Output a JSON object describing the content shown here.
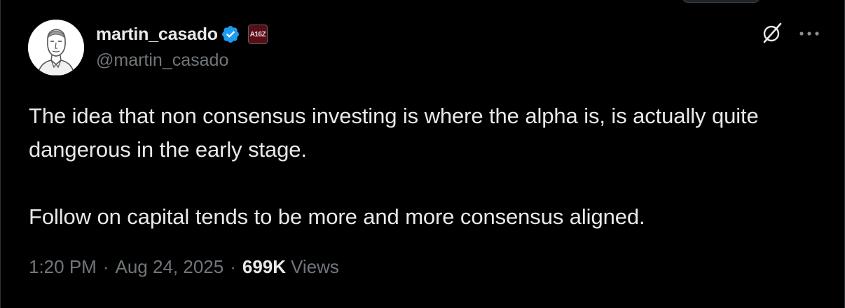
{
  "author": {
    "display_name": "martin_casado",
    "handle": "@martin_casado",
    "verified": true,
    "affiliate_badge": "A16Z",
    "avatar": "avatar-sketch-portrait"
  },
  "tweet": {
    "paragraph_1": "The idea that non consensus investing is where the alpha is, is actually quite dangerous in the early stage.",
    "paragraph_2": "Follow on capital tends to be more and more consensus aligned."
  },
  "meta": {
    "time": "1:20 PM",
    "separator": "·",
    "date": "Aug 24, 2025",
    "views_count": "699K",
    "views_label": "Views"
  },
  "icons": {
    "verified": "verified-badge-icon",
    "grok": "grok-icon",
    "more": "more-icon"
  },
  "colors": {
    "background": "#000000",
    "primary_text": "#e7e9ea",
    "secondary_text": "#71767b",
    "verified_blue": "#1d9bf0",
    "affiliate_badge": "#5b0d17"
  }
}
